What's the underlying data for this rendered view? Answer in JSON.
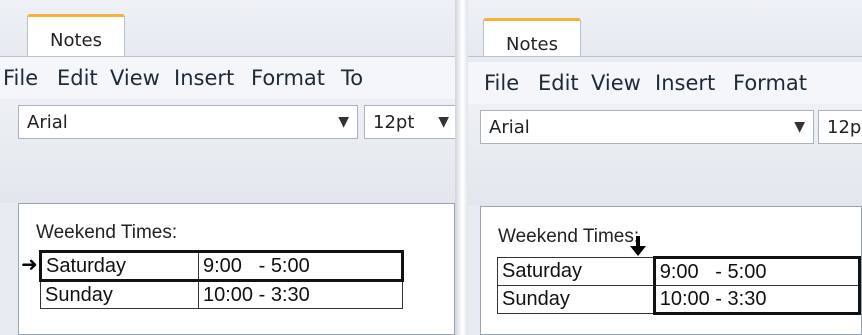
{
  "left": {
    "tab_label": "Notes",
    "menu": [
      "File",
      "Edit",
      "View",
      "Insert",
      "Format",
      "To"
    ],
    "font_name": "Arial",
    "font_size": "12pt",
    "doc_title": "Weekend Times:",
    "rows": [
      {
        "day": "Saturday",
        "time": "9:00   - 5:00"
      },
      {
        "day": "Sunday",
        "time": "10:00 - 3:30"
      }
    ],
    "selection_marker": "row-selector-arrow"
  },
  "right": {
    "tab_label": "Notes",
    "menu": [
      "File",
      "Edit",
      "View",
      "Insert",
      "Format"
    ],
    "font_name": "Arial",
    "font_size": "12p",
    "doc_title": "Weekend Times:",
    "rows": [
      {
        "day": "Saturday",
        "time": "9:00   - 5:00"
      },
      {
        "day": "Sunday",
        "time": "10:00 - 3:30"
      }
    ],
    "selection_marker": "column-selector-arrow"
  },
  "colors": {
    "tab_accent": "#f0b33c",
    "chrome_bg": "#e7ecf3"
  }
}
